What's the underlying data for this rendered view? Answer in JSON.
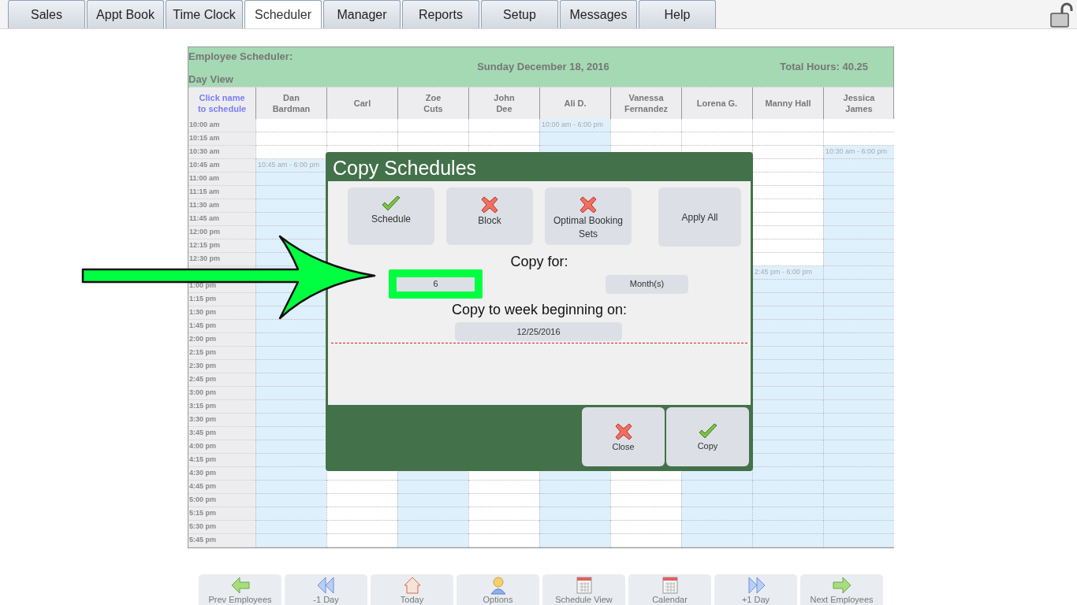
{
  "tabs": [
    {
      "label": "Sales",
      "selected": false
    },
    {
      "label": "Appt Book",
      "selected": false
    },
    {
      "label": "Time Clock",
      "selected": false
    },
    {
      "label": "Scheduler",
      "selected": true
    },
    {
      "label": "Manager",
      "selected": false
    },
    {
      "label": "Reports",
      "selected": false
    },
    {
      "label": "Setup",
      "selected": false
    },
    {
      "label": "Messages",
      "selected": false
    },
    {
      "label": "Help",
      "selected": false
    }
  ],
  "scheduler": {
    "title_lines": [
      "Employee Scheduler:",
      "Day View"
    ],
    "date": "Sunday December 18, 2016",
    "total": "Total Hours: 40.25",
    "hint": [
      "Click name",
      "to schedule"
    ],
    "employees": [
      {
        "name": [
          "Dan",
          "Bardman"
        ],
        "shift_label": "10:45 am - 6:00 pm"
      },
      {
        "name": [
          "Carl"
        ]
      },
      {
        "name": [
          "Zoe",
          "Cuts"
        ]
      },
      {
        "name": [
          "John",
          "Dee"
        ]
      },
      {
        "name": [
          "Ali D."
        ],
        "shift_label": "10:00 am - 6:00 pm"
      },
      {
        "name": [
          "Vanessa",
          "Fernandez"
        ]
      },
      {
        "name": [
          "Lorena G."
        ]
      },
      {
        "name": [
          "Manny Hall"
        ],
        "shift_label": "2:45 pm - 6:00 pm"
      },
      {
        "name": [
          "Jessica",
          "James"
        ],
        "shift_label": "10:30 am - 6:00 pm"
      }
    ],
    "rows": [
      {
        "time": "10:00 am",
        "scheduled": [
          false,
          false,
          false,
          false,
          true,
          false,
          false,
          false,
          false
        ]
      },
      {
        "time": "10:15 am",
        "scheduled": [
          false,
          false,
          false,
          false,
          true,
          false,
          false,
          false,
          false
        ]
      },
      {
        "time": "10:30 am",
        "scheduled": [
          false,
          false,
          false,
          false,
          true,
          false,
          false,
          false,
          true
        ]
      },
      {
        "time": "10:45 am",
        "dialog_covers": true,
        "scheduled": [
          true,
          false,
          true
        ]
      },
      {
        "time": "11:00 am",
        "dialog_covers": true,
        "scheduled": [
          true,
          false,
          true
        ]
      },
      {
        "time": "11:15 am",
        "dialog_covers": true,
        "scheduled": [
          true,
          false,
          true
        ]
      },
      {
        "time": "11:30 am",
        "dialog_covers": true,
        "scheduled": [
          true,
          false,
          true
        ]
      },
      {
        "time": "11:45 am",
        "dialog_covers": true,
        "scheduled": [
          true,
          false,
          true
        ]
      },
      {
        "time": "12:00 pm",
        "dialog_covers": true,
        "scheduled": [
          true,
          false,
          true
        ]
      },
      {
        "time": "12:15 pm",
        "dialog_covers": true,
        "scheduled": [
          true,
          false,
          true
        ]
      },
      {
        "time": "12:30 pm",
        "dialog_covers": true,
        "scheduled": [
          true,
          false,
          true
        ]
      },
      {
        "dialog_covers": true,
        "scheduled": [
          true,
          true,
          true
        ]
      },
      {
        "time": "1:00 pm",
        "dialog_covers": true,
        "scheduled": [
          true,
          true,
          true
        ]
      },
      {
        "time": "1:15 pm",
        "dialog_covers": true,
        "scheduled": [
          true,
          true,
          true
        ]
      },
      {
        "time": "1:30 pm",
        "dialog_covers": true,
        "scheduled": [
          true,
          true,
          true
        ]
      },
      {
        "time": "1:45 pm",
        "dialog_covers": true,
        "scheduled": [
          true,
          true,
          true
        ]
      },
      {
        "time": "2:00 pm",
        "dialog_covers": true,
        "scheduled": [
          true,
          true,
          true
        ]
      },
      {
        "time": "2:15 pm",
        "dialog_covers": true,
        "scheduled": [
          true,
          true,
          true
        ]
      },
      {
        "time": "2:30 pm",
        "dialog_covers": true,
        "scheduled": [
          true,
          true,
          true
        ]
      },
      {
        "time": "2:45 pm",
        "dialog_covers": true,
        "scheduled": [
          true,
          true,
          true
        ]
      },
      {
        "time": "3:00 pm",
        "dialog_covers": true,
        "scheduled": [
          true,
          true,
          true
        ]
      },
      {
        "time": "3:15 pm",
        "dialog_covers": true,
        "scheduled": [
          true,
          true,
          true
        ]
      },
      {
        "time": "3:30 pm",
        "dialog_covers": true,
        "scheduled": [
          true,
          true,
          true
        ]
      },
      {
        "time": "3:45 pm",
        "dialog_covers": true,
        "scheduled": [
          true,
          true,
          true
        ]
      },
      {
        "time": "4:00 pm",
        "dialog_covers": true,
        "scheduled": [
          true,
          true,
          true
        ]
      },
      {
        "time": "4:15 pm",
        "dialog_covers": true,
        "scheduled": [
          true,
          true,
          true
        ]
      },
      {
        "time": "4:30 pm",
        "scheduled": [
          true,
          false,
          true,
          false,
          true,
          false,
          true,
          true,
          true
        ]
      },
      {
        "time": "4:45 pm",
        "scheduled": [
          true,
          false,
          true,
          false,
          true,
          false,
          true,
          true,
          true
        ]
      },
      {
        "time": "5:00 pm",
        "scheduled": [
          true,
          false,
          true,
          false,
          true,
          false,
          true,
          true,
          true
        ]
      },
      {
        "time": "5:15 pm",
        "scheduled": [
          true,
          false,
          true,
          false,
          true,
          false,
          true,
          true,
          true
        ]
      },
      {
        "time": "5:30 pm",
        "scheduled": [
          true,
          false,
          true,
          false,
          true,
          false,
          true,
          true,
          true
        ]
      },
      {
        "time": "5:45 pm",
        "scheduled": [
          true,
          false,
          true,
          false,
          true,
          false,
          true,
          true,
          true
        ]
      }
    ]
  },
  "dialog": {
    "title": "Copy Schedules",
    "options": [
      {
        "label": "Schedule",
        "checked": true
      },
      {
        "label": "Block",
        "checked": false
      },
      {
        "label": "Optimal Booking Sets",
        "checked": false
      }
    ],
    "apply_all": "Apply All",
    "copy_for_label": "Copy for:",
    "count": "6",
    "unit": "Month(s)",
    "week_label": "Copy to week beginning on:",
    "week_date": "12/25/2016",
    "buttons": [
      {
        "label": "Close",
        "kind": "close"
      },
      {
        "label": "Copy",
        "kind": "confirm"
      }
    ]
  },
  "bottom_nav": [
    {
      "label": "Prev Employees",
      "kind": "prev"
    },
    {
      "label": "-1 Day",
      "kind": "back"
    },
    {
      "label": "Today",
      "kind": "home"
    },
    {
      "label": "Options",
      "kind": "person"
    },
    {
      "label": "Schedule View",
      "kind": "grid"
    },
    {
      "label": "Calendar",
      "kind": "calendar"
    },
    {
      "label": "+1 Day",
      "kind": "forward"
    },
    {
      "label": "Next Employees",
      "kind": "next"
    }
  ]
}
